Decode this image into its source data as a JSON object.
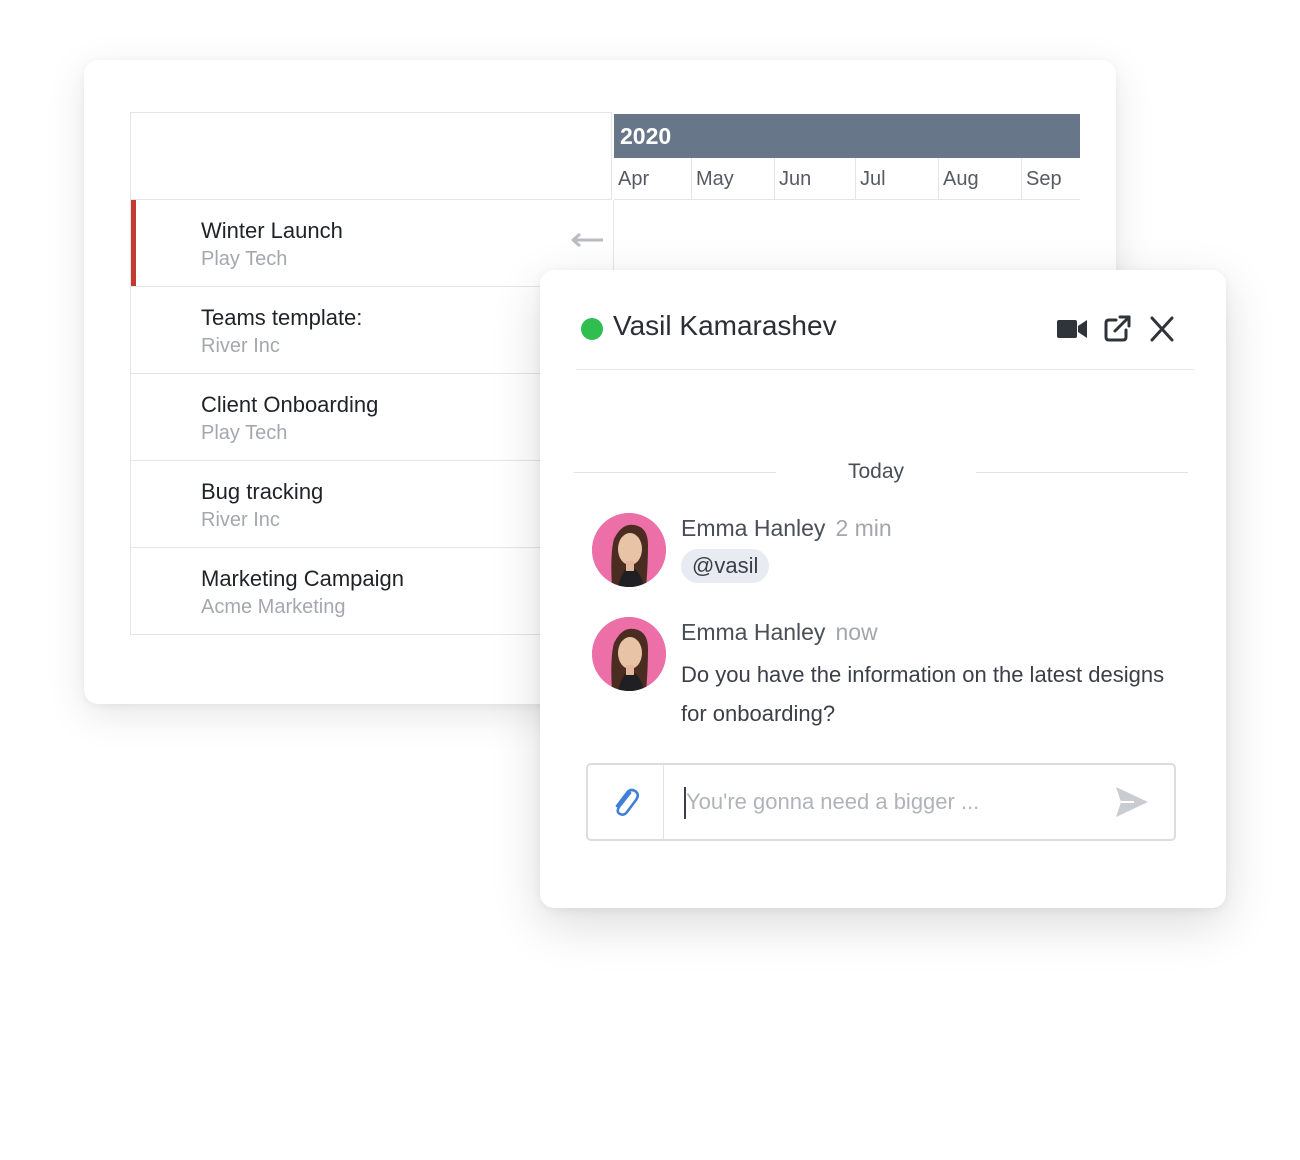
{
  "timeline": {
    "year": "2020",
    "months": [
      "Apr",
      "May",
      "Jun",
      "Jul",
      "Aug",
      "Sep"
    ],
    "rows": [
      {
        "title": "Winter Launch",
        "client": "Play Tech"
      },
      {
        "title": "Teams template:",
        "client": "River Inc"
      },
      {
        "title": "Client Onboarding",
        "client": "Play Tech"
      },
      {
        "title": "Bug tracking",
        "client": "River Inc"
      },
      {
        "title": "Marketing Campaign",
        "client": "Acme Marketing"
      }
    ]
  },
  "chat": {
    "contact_name": "Vasil Kamarashev",
    "status_color": "#2fbf4f",
    "header_icons": [
      "video-camera-icon",
      "popout-icon",
      "close-icon"
    ],
    "date_separator": "Today",
    "messages": [
      {
        "author": "Emma Hanley",
        "time": "2 min",
        "mention": "@vasil"
      },
      {
        "author": "Emma Hanley",
        "time": "now",
        "text": "Do you have the information on the latest designs for onboarding?"
      }
    ],
    "composer": {
      "placeholder": "You're gonna need a bigger ...",
      "value": ""
    }
  },
  "colors": {
    "year_header": "#687689",
    "active_row_marker": "#c23b30",
    "avatar_bg": "#ec6fa8",
    "attach_icon": "#3f7fd6"
  }
}
